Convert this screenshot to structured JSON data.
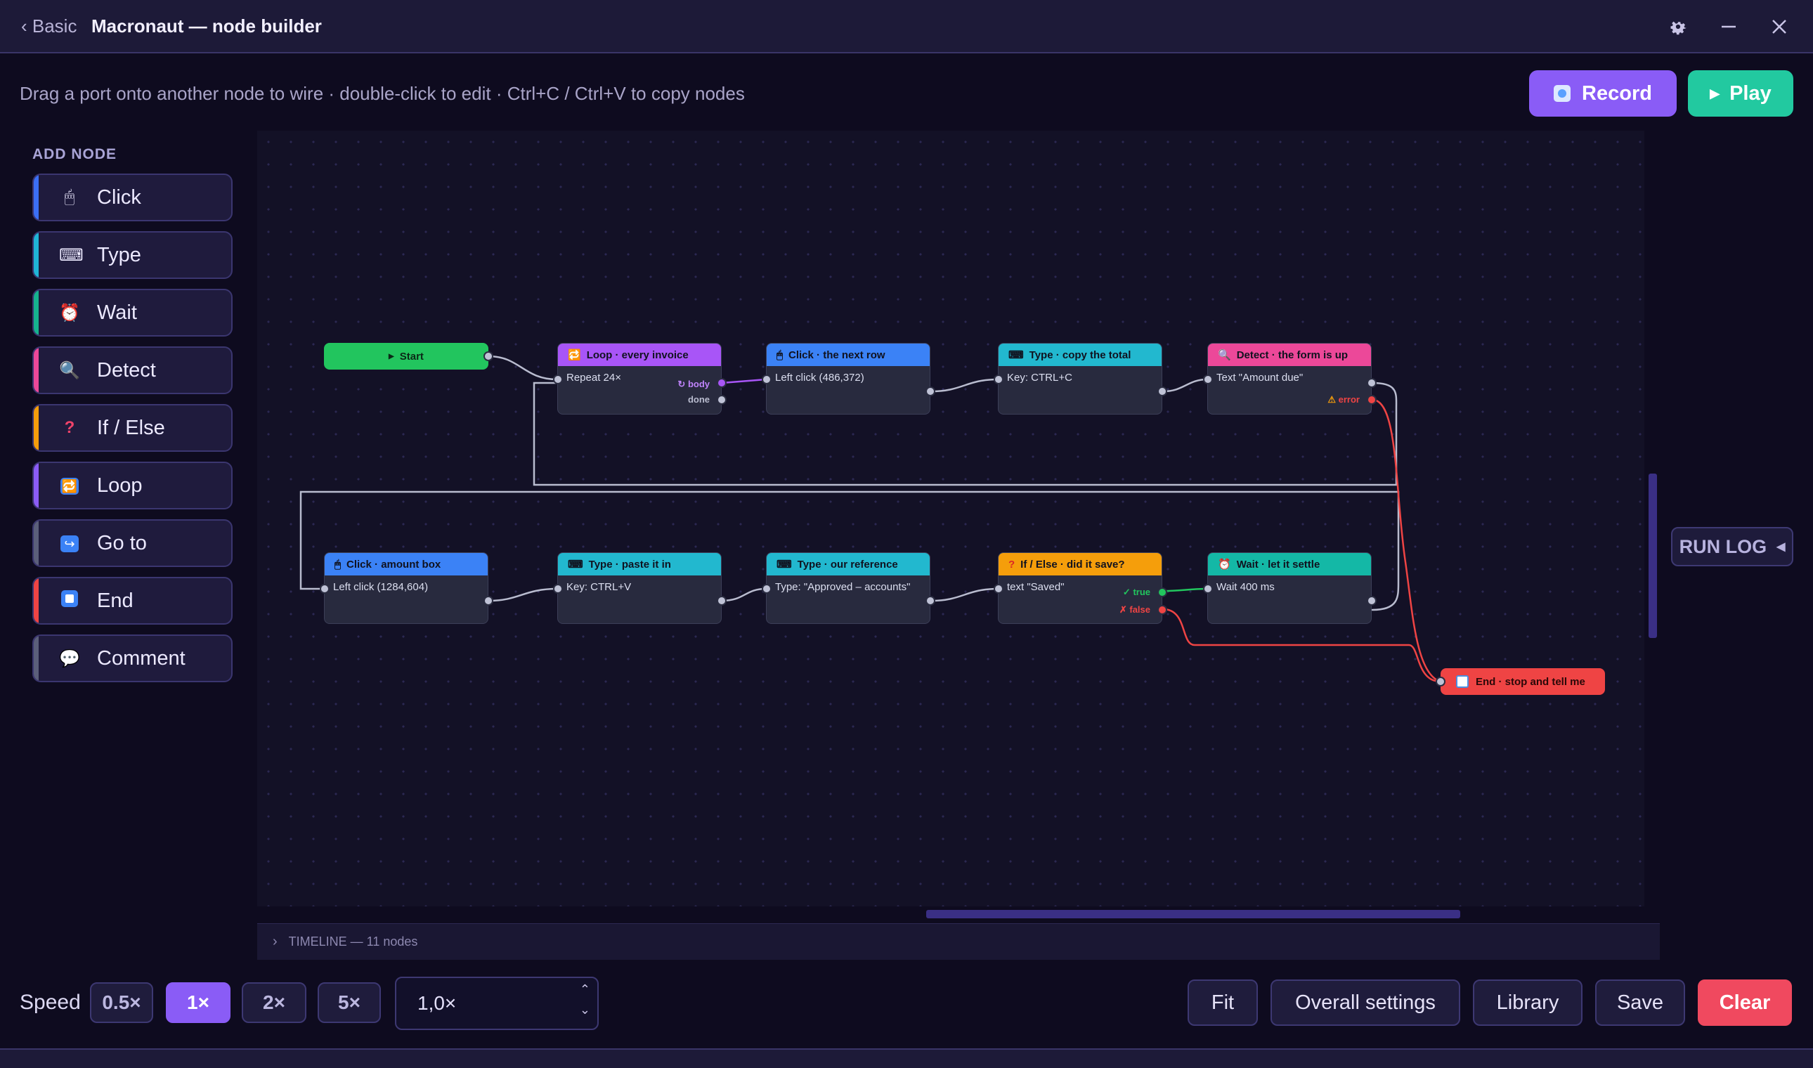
{
  "titlebar": {
    "back_label": "‹ Basic",
    "title": "Macronaut — node builder"
  },
  "hint": "Drag a port onto another node to wire · double-click to edit · Ctrl+C / Ctrl+V to copy nodes",
  "actions": {
    "record": "Record",
    "play": "Play"
  },
  "palette": {
    "title": "ADD NODE",
    "items": [
      {
        "label": "Click",
        "icon": "mouse-icon",
        "color": "#3b6ff5"
      },
      {
        "label": "Type",
        "icon": "keyboard-icon",
        "color": "#1fb5d6"
      },
      {
        "label": "Wait",
        "icon": "alarm-clock-icon",
        "color": "#16b38e"
      },
      {
        "label": "Detect",
        "icon": "magnifier-icon",
        "color": "#ec4899"
      },
      {
        "label": "If / Else",
        "icon": "question-icon",
        "color": "#f59e0b"
      },
      {
        "label": "Loop",
        "icon": "loop-icon",
        "color": "#8b5cf6"
      },
      {
        "label": "Go to",
        "icon": "goto-icon",
        "color": "#5b5f7a"
      },
      {
        "label": "End",
        "icon": "stop-icon",
        "color": "#ef4444"
      },
      {
        "label": "Comment",
        "icon": "comment-icon",
        "color": "#5b5f7a"
      }
    ]
  },
  "nodes": {
    "start": {
      "label": "Start"
    },
    "loop": {
      "title": "Loop · every invoice",
      "body": "Repeat 24×",
      "port_body": "body",
      "port_done": "done",
      "color": "#a855f7"
    },
    "click1": {
      "title": "Click · the next row",
      "body": "Left click (486,372)",
      "color": "#3b82f6"
    },
    "type1": {
      "title": "Type · copy the total",
      "body": "Key: CTRL+C",
      "color": "#22b8cf"
    },
    "detect": {
      "title": "Detect · the form is up",
      "body": "Text \"Amount due\"",
      "port_error": "error",
      "color": "#ec4899"
    },
    "click2": {
      "title": "Click · amount box",
      "body": "Left click (1284,604)",
      "color": "#3b82f6"
    },
    "type2": {
      "title": "Type · paste it in",
      "body": "Key: CTRL+V",
      "color": "#22b8cf"
    },
    "type3": {
      "title": "Type · our reference",
      "body": "Type: \"Approved – accounts\"",
      "color": "#22b8cf"
    },
    "ifelse": {
      "title": "If / Else · did it save?",
      "body": "text \"Saved\"",
      "port_true": "true",
      "port_false": "false",
      "color": "#f59e0b"
    },
    "wait": {
      "title": "Wait · let it settle",
      "body": "Wait 400 ms",
      "color": "#14b8a6"
    },
    "end": {
      "label": "End · stop and tell me",
      "color": "#ef4444"
    }
  },
  "run_log": {
    "label": "RUN LOG"
  },
  "timeline": {
    "label": "TIMELINE — 11 nodes"
  },
  "speed": {
    "label": "Speed",
    "options": [
      "0.5×",
      "1×",
      "2×",
      "5×"
    ],
    "selected": "1×",
    "custom_value": "1,0×"
  },
  "buttons": {
    "fit": "Fit",
    "overall": "Overall settings",
    "library": "Library",
    "save": "Save",
    "clear": "Clear"
  }
}
